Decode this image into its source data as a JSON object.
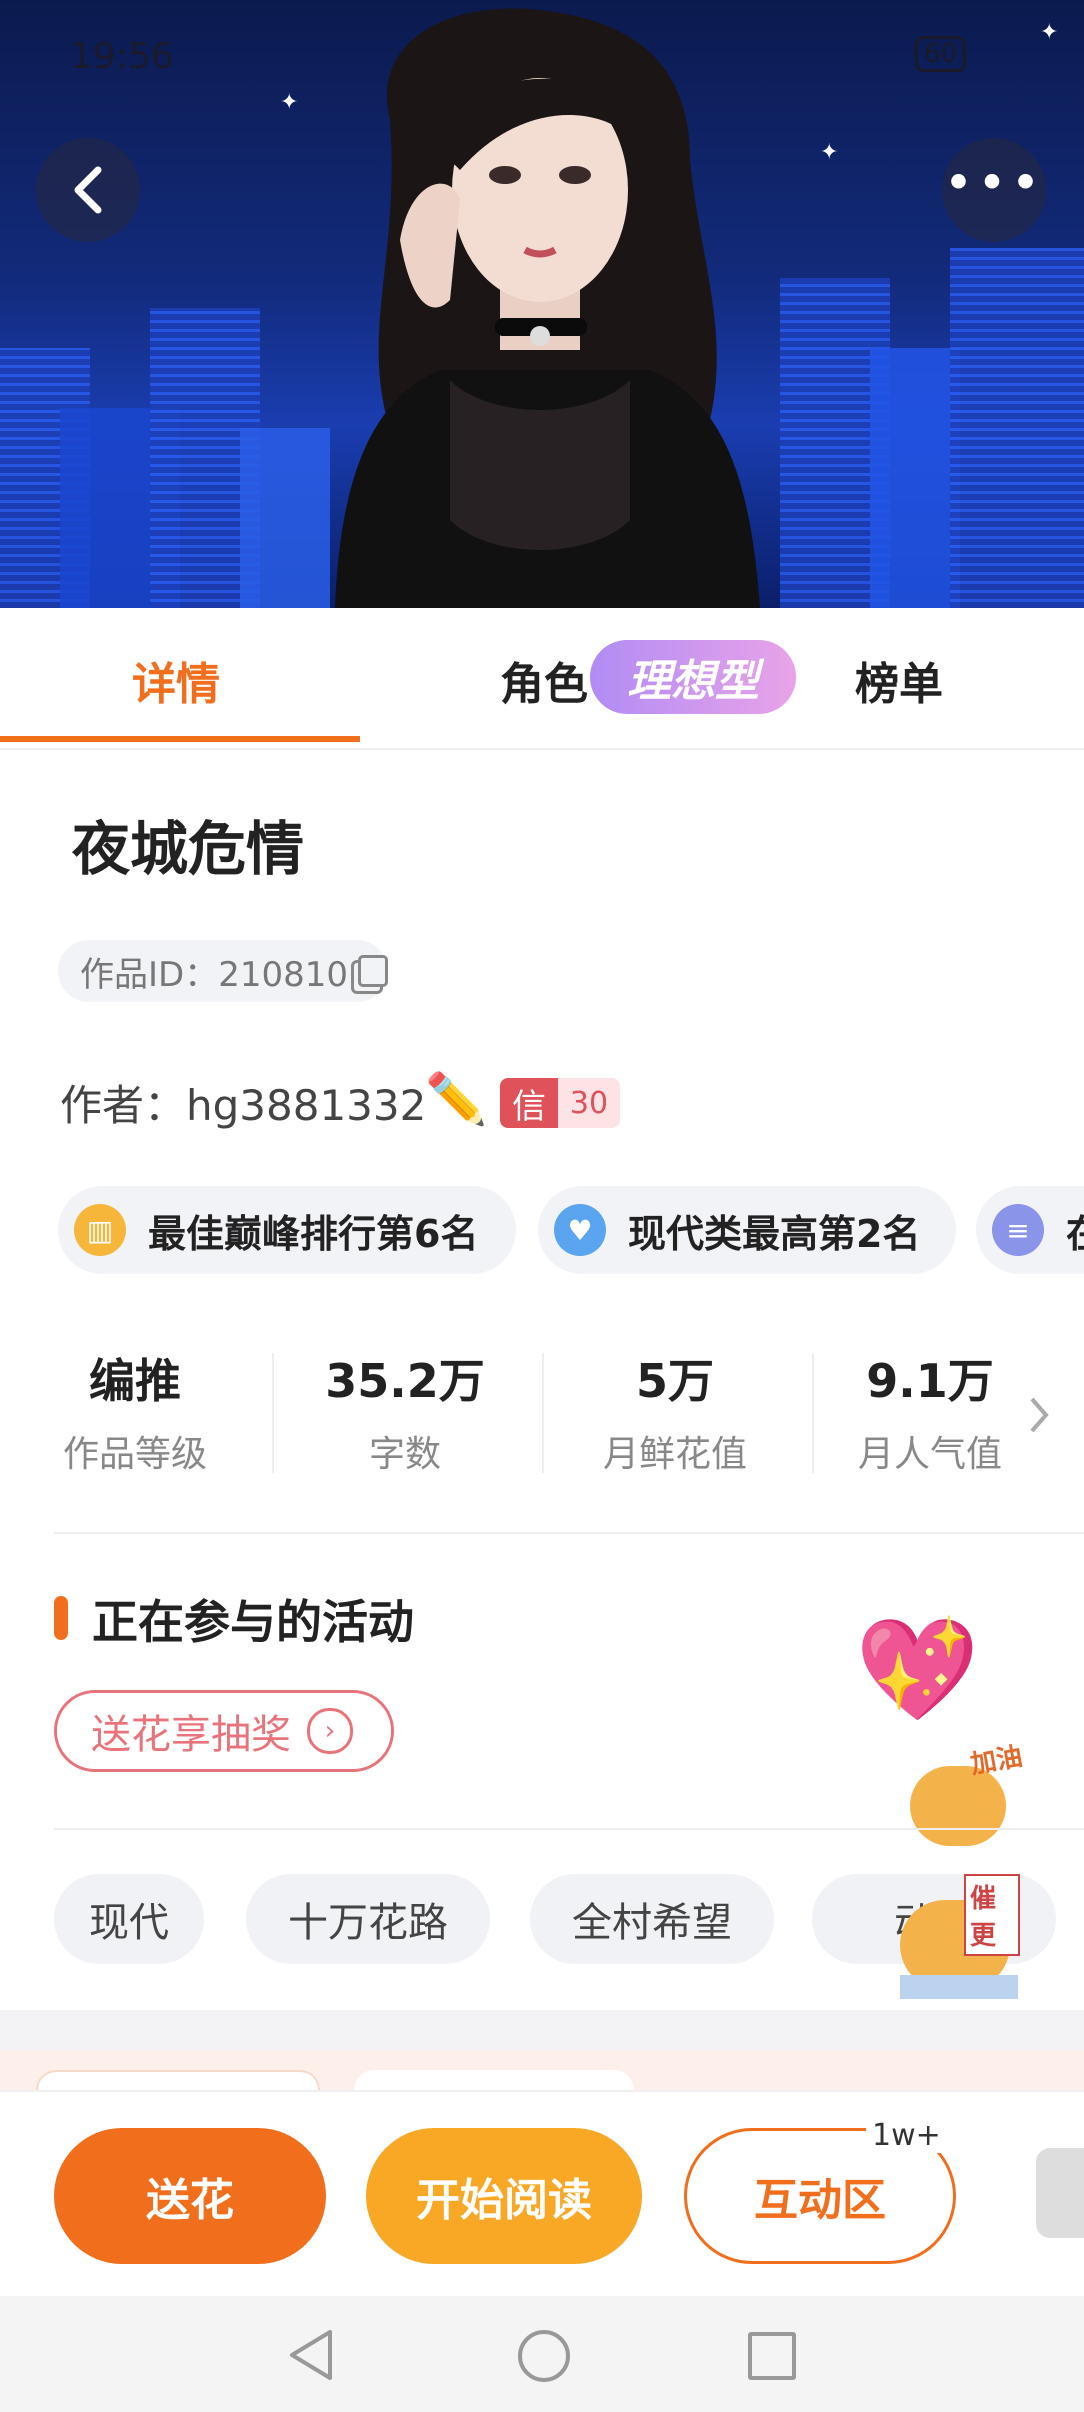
{
  "status": {
    "time": "19:56",
    "battery": "60"
  },
  "tabs": [
    {
      "label": "详情",
      "active": true
    },
    {
      "label": "角色",
      "badge": "理想型"
    },
    {
      "label": "榜单"
    }
  ],
  "work": {
    "title": "夜城危情",
    "id_label": "作品ID：210810",
    "author": "作者：hg3881332",
    "xin_label": "信",
    "xin_value": "30"
  },
  "rank_chips": [
    {
      "text": "最佳巅峰排行第6名",
      "icon": "bar-chart-icon",
      "color": "#f5b63a"
    },
    {
      "text": "现代类最高第2名",
      "icon": "heart-shield-icon",
      "color": "#5aa4f0"
    },
    {
      "text": "在",
      "icon": "book-icon",
      "color": "#8a94e8"
    }
  ],
  "stats": [
    {
      "value": "编推",
      "label": "作品等级"
    },
    {
      "value": "35.2万",
      "label": "字数"
    },
    {
      "value": "5万",
      "label": "月鲜花值"
    },
    {
      "value": "9.1万",
      "label": "月人气值"
    }
  ],
  "activity": {
    "heading": "正在参与的活动",
    "item": "送花享抽奖"
  },
  "tags": [
    "现代",
    "十万花路",
    "全村希望",
    "动人"
  ],
  "stickers": {
    "cheer": "加油",
    "urge": "催更"
  },
  "actions": {
    "gift": "送花",
    "read": "开始阅读",
    "interact": "互动区",
    "interact_badge": "1w+"
  },
  "colors": {
    "accent": "#f06e1c",
    "read": "#f9a825",
    "pink": "#e8737a"
  }
}
